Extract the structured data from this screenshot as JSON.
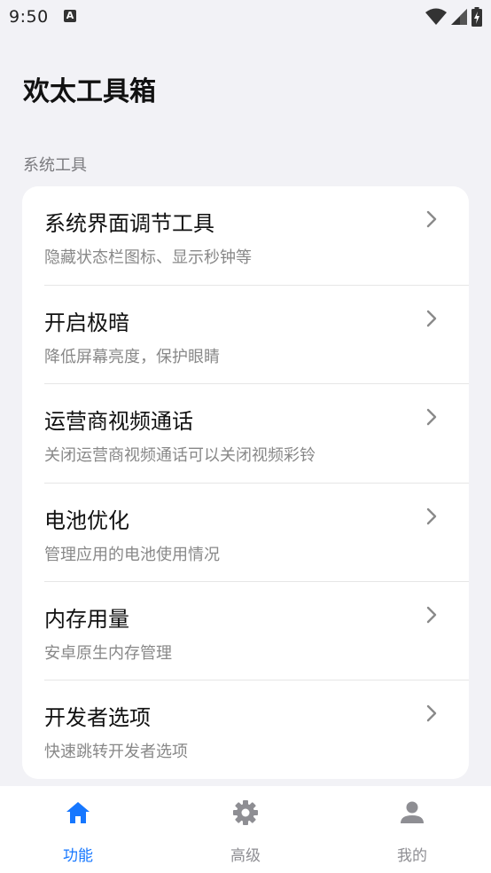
{
  "status_bar": {
    "time": "9:50",
    "notification_icon": "a-icon",
    "wifi_icon": "wifi-icon",
    "signal_icon": "signal-icon",
    "battery_icon": "battery-charging-icon"
  },
  "page": {
    "title": "欢太工具箱"
  },
  "section": {
    "label": "系统工具"
  },
  "items": [
    {
      "title": "系统界面调节工具",
      "subtitle": "隐藏状态栏图标、显示秒钟等",
      "icon": "chevron-right-icon"
    },
    {
      "title": "开启极暗",
      "subtitle": "降低屏幕亮度，保护眼睛",
      "icon": "chevron-right-icon"
    },
    {
      "title": "运营商视频通话",
      "subtitle": "关闭运营商视频通话可以关闭视频彩铃",
      "icon": "chevron-right-icon"
    },
    {
      "title": "电池优化",
      "subtitle": "管理应用的电池使用情况",
      "icon": "chevron-right-icon"
    },
    {
      "title": "内存用量",
      "subtitle": "安卓原生内存管理",
      "icon": "chevron-right-icon"
    },
    {
      "title": "开发者选项",
      "subtitle": "快速跳转开发者选项",
      "icon": "chevron-right-icon"
    }
  ],
  "bottom_nav": {
    "tabs": [
      {
        "label": "功能",
        "icon": "home-icon",
        "active": true
      },
      {
        "label": "高级",
        "icon": "gear-icon",
        "active": false
      },
      {
        "label": "我的",
        "icon": "person-icon",
        "active": false
      }
    ]
  },
  "colors": {
    "background": "#f2f2f6",
    "card": "#ffffff",
    "accent": "#1677ff",
    "inactive": "#8e8e93",
    "text_primary": "#111111",
    "text_secondary": "#888888"
  }
}
